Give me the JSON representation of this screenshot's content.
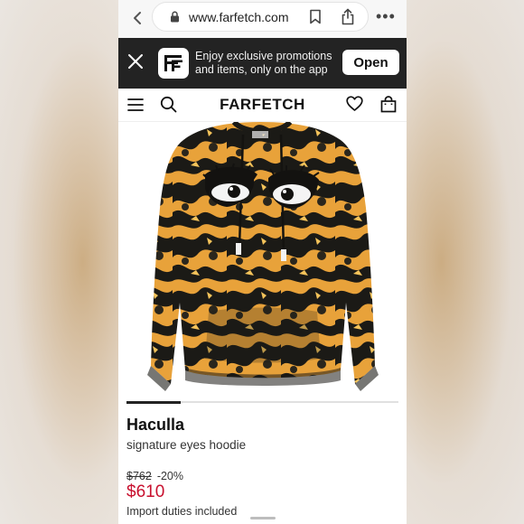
{
  "browser": {
    "url": "www.farfetch.com"
  },
  "app_banner": {
    "logo_text": "FF",
    "message": "Enjoy exclusive promotions and items, only on the app",
    "open_label": "Open"
  },
  "header": {
    "brand": "FARFETCH"
  },
  "product": {
    "designer": "Haculla",
    "name": "signature eyes hoodie",
    "original_price": "$762",
    "discount": "-20%",
    "sale_price": "$610",
    "duties_note": "Import duties included"
  },
  "carousel": {
    "progress_fraction": 0.2
  },
  "colors": {
    "banner_bg": "#232323",
    "sale_price": "#c8102e",
    "hoodie_orange": "#e8a23a",
    "hoodie_dark": "#1b1a16"
  }
}
